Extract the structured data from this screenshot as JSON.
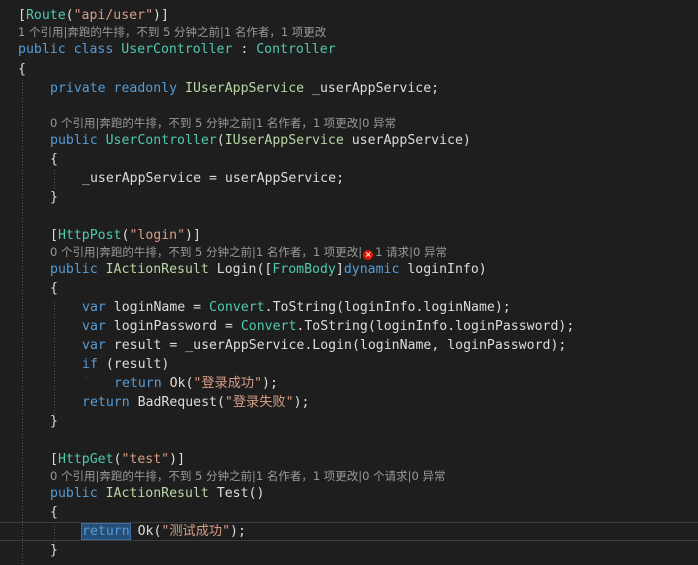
{
  "theme": {
    "background": "#1e1e1e",
    "keyword": "#569cd6",
    "type": "#4ec9b0",
    "interface": "#b8d7a3",
    "string": "#d69d85",
    "text": "#dcdcdc",
    "codelens": "#999999",
    "selection": "#264f78",
    "error_icon": "#e51400"
  },
  "code": {
    "l1": {
      "open": "[",
      "attr": "Route",
      "paren": "(",
      "str": "\"api/user\"",
      "close": ")]"
    },
    "lens1": "1 个引用|奔跑的牛排，不到 5 分钟之前|1 名作者，1 项更改",
    "l2": {
      "kw1": "public",
      "kw2": "class",
      "name": "UserController",
      "colon": " : ",
      "base": "Controller"
    },
    "l3": "{",
    "l4": {
      "kw1": "private",
      "kw2": "readonly",
      "type": "IUserAppService",
      "rest": " _userAppService;"
    },
    "lens2": "0 个引用|奔跑的牛排，不到 5 分钟之前|1 名作者，1 项更改|0 异常",
    "l5": {
      "kw": "public",
      "name": "UserController",
      "p1": "(",
      "type": "IUserAppService",
      "rest": " userAppService)"
    },
    "l6": "{",
    "l7": "_userAppService = userAppService;",
    "l8": "}",
    "l9": {
      "open": "[",
      "attr": "HttpPost",
      "paren": "(",
      "str": "\"login\"",
      "close": ")]"
    },
    "lens3": {
      "before": "0 个引用|奔跑的牛排，不到 5 分钟之前|1 名作者，1 项更改|",
      "error_icon": "×",
      "after": "1 请求|0 异常"
    },
    "l10": {
      "kw": "public",
      "type": "IActionResult",
      "name": " Login(",
      "br1": "[",
      "attr": "FromBody",
      "br2": "]",
      "kw2": "dynamic",
      "rest": " loginInfo)"
    },
    "l11": "{",
    "l12": {
      "kw": "var",
      "name": " loginName = ",
      "cls": "Convert",
      "rest": ".ToString(loginInfo.loginName);"
    },
    "l13": {
      "kw": "var",
      "name": " loginPassword = ",
      "cls": "Convert",
      "rest": ".ToString(loginInfo.loginPassword);"
    },
    "l14": {
      "kw": "var",
      "rest": " result = _userAppService.Login(loginName, loginPassword);"
    },
    "l15": {
      "kw": "if",
      "rest": " (result)"
    },
    "l16": {
      "kw": "return",
      "call": " Ok(",
      "str": "\"登录成功\"",
      "end": ");"
    },
    "l17": {
      "kw": "return",
      "call": " BadRequest(",
      "str": "\"登录失败\"",
      "end": ");"
    },
    "l18": "}",
    "l19": {
      "open": "[",
      "attr": "HttpGet",
      "paren": "(",
      "str": "\"test\"",
      "close": ")]"
    },
    "lens4": "0 个引用|奔跑的牛排，不到 5 分钟之前|1 名作者，1 项更改|0 个请求|0 异常",
    "l20": {
      "kw": "public",
      "type": "IActionResult",
      "rest": " Test()"
    },
    "l21": "{",
    "l22": {
      "kw": "return",
      "call": " Ok(",
      "str": "\"测试成功\"",
      "end": ");"
    },
    "l23": "}"
  }
}
